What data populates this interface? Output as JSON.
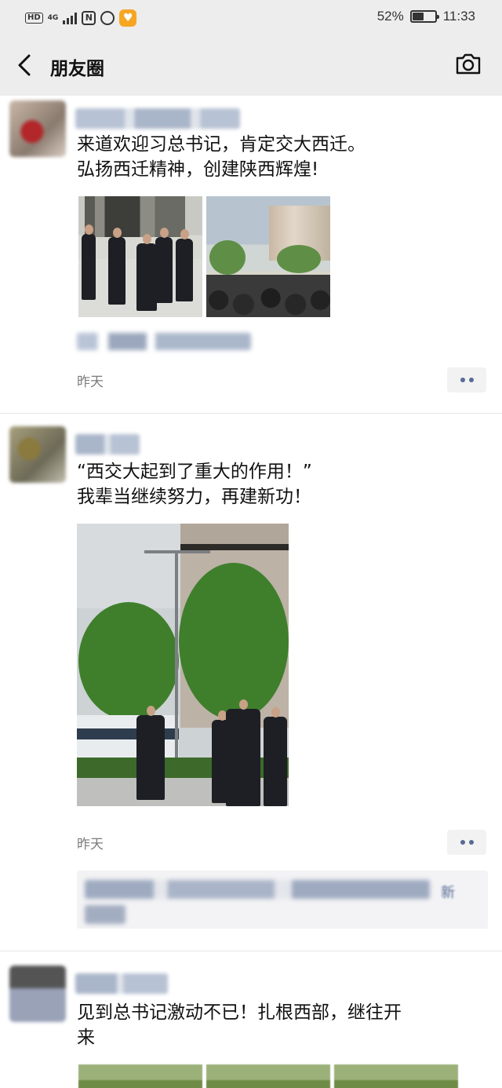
{
  "status_bar": {
    "network": "4G",
    "battery": "52%",
    "battery_level": 0.52,
    "time": "11:33"
  },
  "nav": {
    "title": "朋友圈",
    "back_icon": "chevron-left-icon",
    "camera_icon": "camera-icon"
  },
  "posts": [
    {
      "lines": [
        "来道欢迎习总书记，肯定交大西迁。",
        "弘扬西迁精神，创建陕西辉煌!"
      ],
      "time": "昨天"
    },
    {
      "lines": [
        "“西交大起到了重大的作用！”",
        "我辈当继续努力，再建新功！"
      ],
      "time": "昨天",
      "comment_tail": "新"
    },
    {
      "lines": [
        "见到总书记激动不已！扎根西部，继往开",
        "来"
      ]
    }
  ],
  "colors": {
    "nav_bg": "#ededed",
    "link_blue": "#576b95",
    "time_gray": "#7b7b7b"
  }
}
